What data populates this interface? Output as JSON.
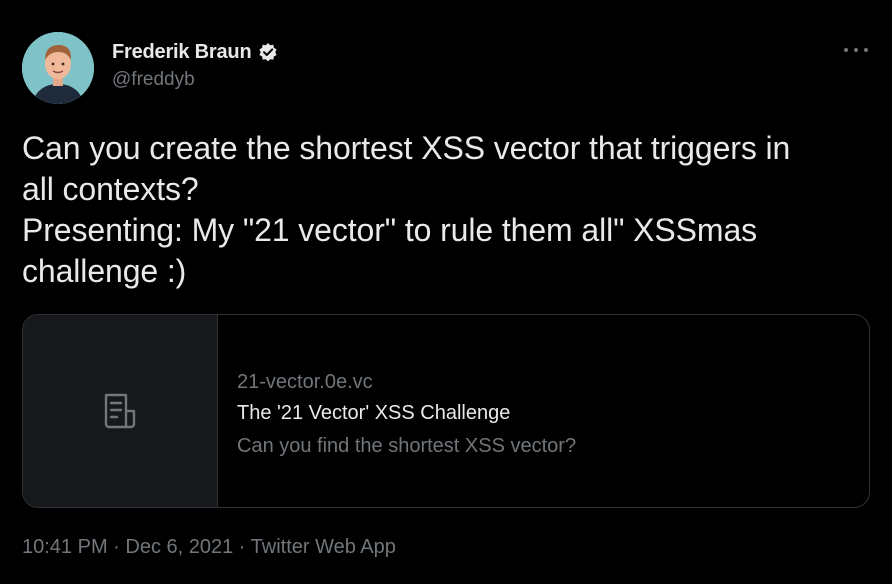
{
  "author": {
    "display_name": "Frederik Braun",
    "handle": "@freddyb",
    "avatar_icon": "user-avatar",
    "verified_icon": "verified-badge-icon"
  },
  "menu": {
    "more_icon": "more-options-icon"
  },
  "tweet": {
    "lines": [
      "Can you create the shortest XSS vector that triggers in",
      "all contexts?",
      "Presenting: My \"21 vector\" to rule them all\" XSSmas",
      "challenge :)"
    ]
  },
  "card": {
    "thumbnail_icon": "document-icon",
    "domain": "21-vector.0e.vc",
    "title": "The '21 Vector' XSS Challenge",
    "description": "Can you find the shortest XSS vector?"
  },
  "meta": {
    "text": "10:41 PM · Dec 6, 2021 · Twitter Web App"
  },
  "colors": {
    "background": "#000000",
    "text_primary": "#e7e9ea",
    "text_secondary": "#71767b",
    "border": "#2f3336",
    "card_thumb_bg": "#16181c"
  }
}
